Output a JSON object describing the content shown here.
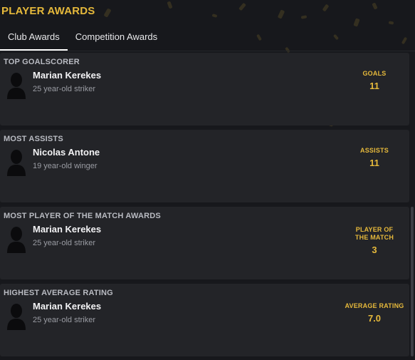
{
  "header": {
    "title": "PLAYER AWARDS"
  },
  "tabs": [
    {
      "label": "Club Awards",
      "active": true
    },
    {
      "label": "Competition Awards",
      "active": false
    }
  ],
  "awards": [
    {
      "title": "TOP GOALSCORER",
      "player_name": "Marian Kerekes",
      "player_desc": "25 year-old striker",
      "stat_label": "GOALS",
      "stat_value": "11"
    },
    {
      "title": "MOST ASSISTS",
      "player_name": "Nicolas Antone",
      "player_desc": "19 year-old winger",
      "stat_label": "ASSISTS",
      "stat_value": "11"
    },
    {
      "title": "MOST PLAYER OF THE MATCH AWARDS",
      "player_name": "Marian Kerekes",
      "player_desc": "25 year-old striker",
      "stat_label": "PLAYER OF THE MATCH",
      "stat_value": "3"
    },
    {
      "title": "HIGHEST AVERAGE RATING",
      "player_name": "Marian Kerekes",
      "player_desc": "25 year-old striker",
      "stat_label": "AVERAGE RATING",
      "stat_value": "7.0"
    }
  ],
  "colors": {
    "accent": "#e6b93b",
    "background": "#17181c",
    "card": "#232428"
  },
  "icons": {
    "avatar": "player-silhouette-icon"
  }
}
